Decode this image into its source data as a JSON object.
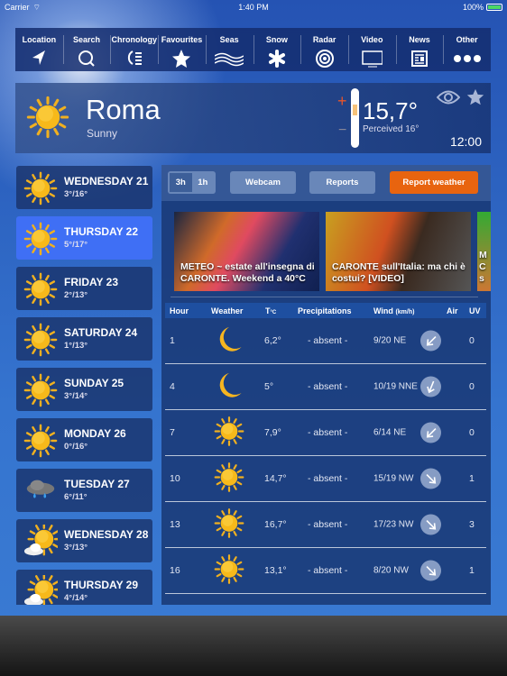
{
  "status": {
    "carrier": "Carrier",
    "time": "1:40 PM",
    "battery": "100%"
  },
  "nav": [
    {
      "label": "Location",
      "icon": "location-arrow-icon"
    },
    {
      "label": "Search",
      "icon": "search-icon"
    },
    {
      "label": "Chronology",
      "icon": "chronology-icon"
    },
    {
      "label": "Favourites",
      "icon": "star-icon"
    },
    {
      "label": "Seas",
      "icon": "waves-icon"
    },
    {
      "label": "Snow",
      "icon": "snowflake-icon"
    },
    {
      "label": "Radar",
      "icon": "radar-icon"
    },
    {
      "label": "Video",
      "icon": "tv-icon"
    },
    {
      "label": "News",
      "icon": "newspaper-icon"
    },
    {
      "label": "Other",
      "icon": "more-dots-icon"
    }
  ],
  "current": {
    "city": "Roma",
    "condition": "Sunny",
    "temperature": "15,7°",
    "perceived": "Perceived 16°",
    "time": "12:00",
    "plus": "+",
    "minus": "−"
  },
  "days": [
    {
      "name": "WEDNESDAY 21",
      "temps": "3°/16°",
      "icon": "sun"
    },
    {
      "name": "THURSDAY 22",
      "temps": "5°/17°",
      "icon": "sun",
      "selected": true
    },
    {
      "name": "FRIDAY 23",
      "temps": "2°/13°",
      "icon": "sun"
    },
    {
      "name": "SATURDAY 24",
      "temps": "1°/13°",
      "icon": "sun"
    },
    {
      "name": "SUNDAY 25",
      "temps": "3°/14°",
      "icon": "sun"
    },
    {
      "name": "MONDAY 26",
      "temps": "0°/16°",
      "icon": "sun"
    },
    {
      "name": "TUESDAY 27",
      "temps": "6°/11°",
      "icon": "rain"
    },
    {
      "name": "WEDNESDAY 28",
      "temps": "3°/13°",
      "icon": "sun-cloud"
    },
    {
      "name": "THURSDAY 29",
      "temps": "4°/14°",
      "icon": "sun-cloud"
    }
  ],
  "toolbar": {
    "seg_3h": "3h",
    "seg_1h": "1h",
    "webcam": "Webcam",
    "reports": "Reports",
    "report_weather": "Report weather",
    "accent": "#e8640f"
  },
  "news": [
    {
      "title": "METEO ~ estate all'insegna di CARONTE. Weekend a 40°C"
    },
    {
      "title": "CARONTE sull'Italia: ma chi è costui? [VIDEO]"
    },
    {
      "title": "M C s"
    }
  ],
  "table": {
    "headers": {
      "hour": "Hour",
      "weather": "Weather",
      "temp": "T",
      "temp_unit": "°C",
      "precip": "Precipitations",
      "wind": "Wind",
      "wind_unit": "(km/h)",
      "air": "Air",
      "uv": "UV"
    },
    "rows": [
      {
        "hour": "1",
        "icon": "moon",
        "temp": "6,2°",
        "precip": "- absent -",
        "wind": "9/20 NE",
        "dir": "NE",
        "uv": "0"
      },
      {
        "hour": "4",
        "icon": "moon",
        "temp": "5°",
        "precip": "- absent -",
        "wind": "10/19 NNE",
        "dir": "NNE",
        "uv": "0"
      },
      {
        "hour": "7",
        "icon": "sun",
        "temp": "7,9°",
        "precip": "- absent -",
        "wind": "6/14 NE",
        "dir": "NE",
        "uv": "0"
      },
      {
        "hour": "10",
        "icon": "sun",
        "temp": "14,7°",
        "precip": "- absent -",
        "wind": "15/19 NW",
        "dir": "NW",
        "uv": "1"
      },
      {
        "hour": "13",
        "icon": "sun",
        "temp": "16,7°",
        "precip": "- absent -",
        "wind": "17/23 NW",
        "dir": "NW",
        "uv": "3"
      },
      {
        "hour": "16",
        "icon": "sun",
        "temp": "13,1°",
        "precip": "- absent -",
        "wind": "8/20 NW",
        "dir": "NW",
        "uv": "1"
      }
    ]
  }
}
